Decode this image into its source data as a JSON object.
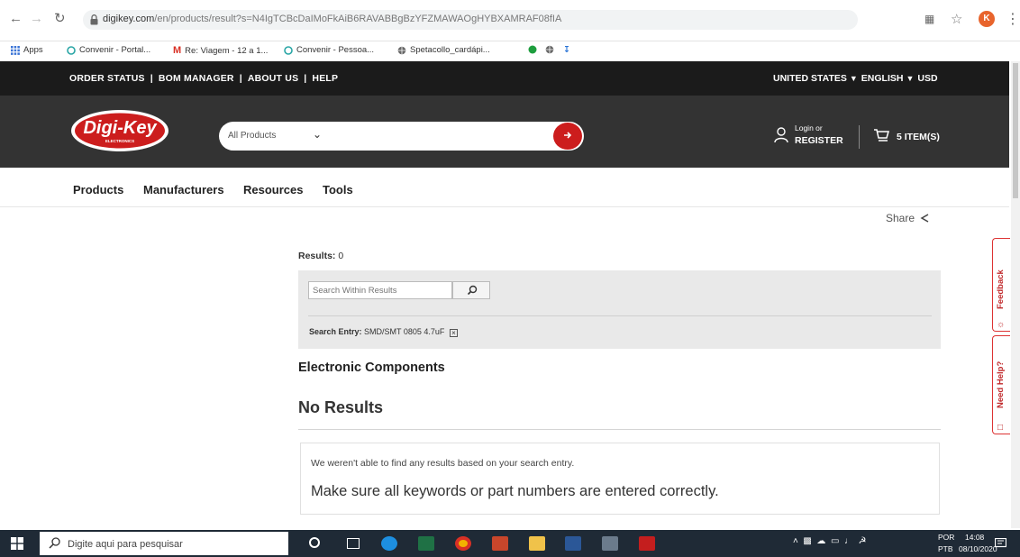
{
  "browser": {
    "url_host": "digikey.com",
    "url_path": "/en/products/result?s=N4IgTCBcDaIMoFkAiB6RAVABBgBzYFZMAWAOgHYBXAMRAF08fIA",
    "profile_initial": "K",
    "bookmarks": [
      {
        "label": "Apps"
      },
      {
        "label": "Convenir - Portal..."
      },
      {
        "label": "Re: Viagem - 12 a 1..."
      },
      {
        "label": "Convenir - Pessoa..."
      },
      {
        "label": "Spetacollo_cardápi..."
      }
    ]
  },
  "topbar": {
    "links": [
      "ORDER STATUS",
      "BOM MANAGER",
      "ABOUT US",
      "HELP"
    ],
    "separator": "|",
    "country": "UNITED STATES",
    "language": "ENGLISH",
    "currency": "USD"
  },
  "header": {
    "logo_text": "Digi-Key",
    "logo_sub": "ELECTRONICS",
    "search_category": "All Products",
    "login_label": "Login or",
    "register_label": "REGISTER",
    "cart_label": "5 ITEM(S)"
  },
  "nav": {
    "items": [
      "Products",
      "Manufacturers",
      "Resources",
      "Tools"
    ]
  },
  "content": {
    "share_label": "Share",
    "results_label": "Results:",
    "results_count": "0",
    "within_placeholder": "Search Within Results",
    "search_entry_label": "Search Entry:",
    "search_entry_value": "SMD/SMT 0805 4.7uF",
    "section_title": "Electronic Components",
    "no_results_title": "No Results",
    "message_line1": "We weren't able to find any results based on your search entry.",
    "message_line2": "Make sure all keywords or part numbers are entered correctly."
  },
  "side_tabs": {
    "feedback": "Feedback",
    "need_help": "Need Help?"
  },
  "taskbar": {
    "search_placeholder": "Digite aqui para pesquisar",
    "lang_top": "POR",
    "lang_bottom": "PTB",
    "time": "14:08",
    "date": "08/10/2020"
  },
  "colors": {
    "brand_red": "#cc1d1d",
    "header_dark": "#333333",
    "topbar_black": "#1b1b1b"
  }
}
